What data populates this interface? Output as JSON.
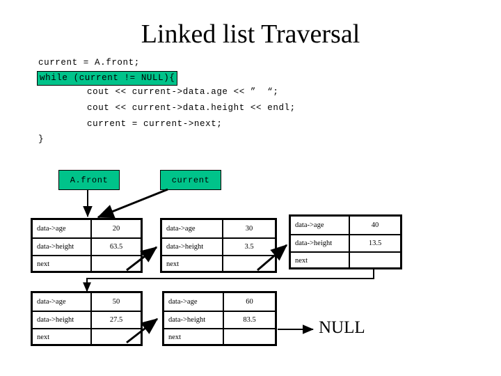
{
  "slide": {
    "title": "Linked list Traversal",
    "background_color": "#ffffff",
    "highlight_color": "#00C38A",
    "ink_color": "#000000"
  },
  "code": {
    "lines": [
      {
        "text": "current = A.front;",
        "highlighted": false,
        "indent": 0
      },
      {
        "text": "while (current != NULL){",
        "highlighted": true,
        "indent": 0
      },
      {
        "text": "cout << current->data.age << ”  “;",
        "highlighted": false,
        "indent": 1
      },
      {
        "text": "cout << current->data.height << endl;",
        "highlighted": false,
        "indent": 1
      },
      {
        "text": "current = current->next;",
        "highlighted": false,
        "indent": 1
      },
      {
        "text": "}",
        "highlighted": false,
        "indent": 0
      }
    ]
  },
  "pointers": [
    {
      "label": "A.front",
      "name": "a-front"
    },
    {
      "label": "current",
      "name": "current"
    }
  ],
  "node_fields": {
    "age_label": "data->age",
    "height_label": "data->height",
    "next_label": "next"
  },
  "nodes": [
    {
      "id": "node-1",
      "age": "20",
      "height": "63.5"
    },
    {
      "id": "node-2",
      "age": "30",
      "height": "3.5"
    },
    {
      "id": "node-3",
      "age": "40",
      "height": "13.5"
    },
    {
      "id": "node-4",
      "age": "50",
      "height": "27.5"
    },
    {
      "id": "node-5",
      "age": "60",
      "height": "83.5"
    }
  ],
  "terminator": {
    "label": "NULL"
  }
}
